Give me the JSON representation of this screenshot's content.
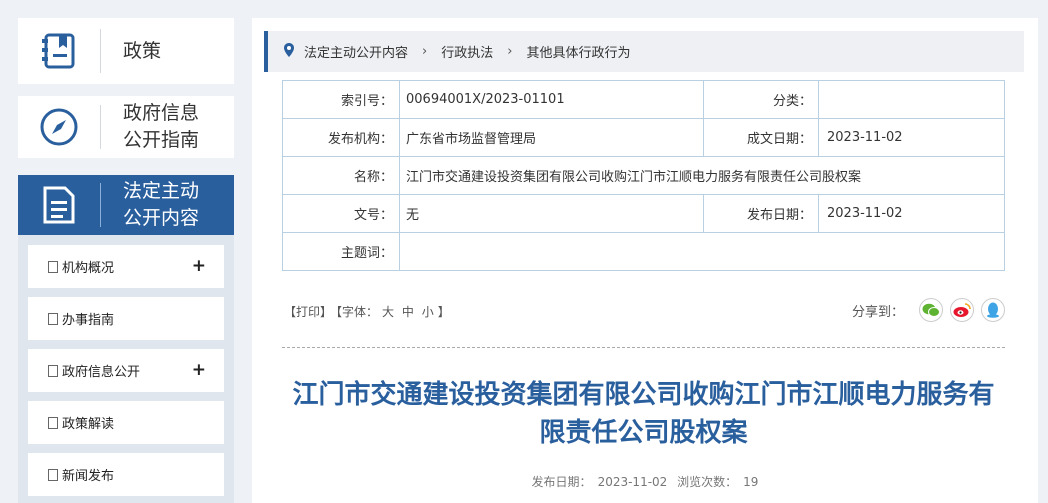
{
  "sidebar": {
    "policy_label": "政策",
    "guide_label_1": "政府信息",
    "guide_label_2": "公开指南",
    "active_label_1": "法定主动",
    "active_label_2": "公开内容",
    "menu": [
      {
        "label": "机构概况",
        "has_plus": true
      },
      {
        "label": "办事指南",
        "has_plus": false
      },
      {
        "label": "政府信息公开",
        "has_plus": true
      },
      {
        "label": "政策解读",
        "has_plus": false
      },
      {
        "label": "新闻发布",
        "has_plus": false
      }
    ],
    "plus_symbol": "+"
  },
  "breadcrumb": {
    "items": [
      "法定主动公开内容",
      "行政执法",
      "其他具体行政行为"
    ],
    "separator": "›"
  },
  "meta": {
    "index_label": "索引号：",
    "index_value": "00694001X/2023-01101",
    "category_label": "分类：",
    "category_value": "",
    "publisher_label": "发布机构：",
    "publisher_value": "广东省市场监督管理局",
    "created_label": "成文日期：",
    "created_value": "2023-11-02",
    "name_label": "名称：",
    "name_value": "江门市交通建设投资集团有限公司收购江门市江顺电力服务有限责任公司股权案",
    "docno_label": "文号：",
    "docno_value": "无",
    "published_label": "发布日期：",
    "published_value": "2023-11-02",
    "keywords_label": "主题词：",
    "keywords_value": ""
  },
  "tools": {
    "print": "【打印】",
    "font_prefix": "【字体：",
    "font_large": "大",
    "font_medium": "中",
    "font_small": "小",
    "font_suffix": "】"
  },
  "share": {
    "label": "分享到：",
    "icons": [
      "wechat-icon",
      "weibo-icon",
      "qq-icon"
    ],
    "colors": {
      "wechat": "#5fb332",
      "weibo": "#e6162d",
      "qq": "#3ea4e6"
    }
  },
  "article": {
    "title": "江门市交通建设投资集团有限公司收购江门市江顺电力服务有限责任公司股权案",
    "date_label": "发布日期：",
    "date_value": "2023-11-02",
    "views_label": "浏览次数：",
    "views_value": "19"
  },
  "colors": {
    "accent": "#2a5f9e",
    "border": "#b9cfe2",
    "page_bg": "#eef1f5"
  }
}
